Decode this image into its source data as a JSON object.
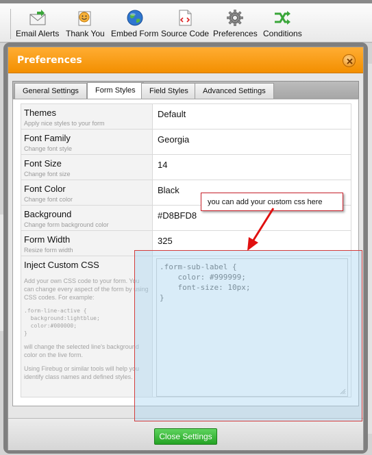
{
  "toolbar": {
    "items": [
      {
        "label": "Email Alerts",
        "icon": "email-icon"
      },
      {
        "label": "Thank You",
        "icon": "thank-you-icon"
      },
      {
        "label": "Embed Form",
        "icon": "globe-icon"
      },
      {
        "label": "Source Code",
        "icon": "source-code-icon"
      },
      {
        "label": "Preferences",
        "icon": "gear-icon"
      },
      {
        "label": "Conditions",
        "icon": "conditions-icon"
      }
    ]
  },
  "modal": {
    "title": "Preferences",
    "tabs": [
      {
        "label": "General Settings",
        "active": false
      },
      {
        "label": "Form Styles",
        "active": true
      },
      {
        "label": "Field Styles",
        "active": false
      },
      {
        "label": "Advanced Settings",
        "active": false
      }
    ],
    "settings": [
      {
        "name": "Themes",
        "desc": "Apply nice styles to your form",
        "value": "Default"
      },
      {
        "name": "Font Family",
        "desc": "Change font style",
        "value": "Georgia"
      },
      {
        "name": "Font Size",
        "desc": "Change font size",
        "value": "14"
      },
      {
        "name": "Font Color",
        "desc": "Change font color",
        "value": "Black"
      },
      {
        "name": "Background",
        "desc": "Change form background color",
        "value": "#D8BFD8"
      },
      {
        "name": "Form Width",
        "desc": "Resize form width",
        "value": "325"
      }
    ],
    "custom_css": {
      "name": "Inject Custom CSS",
      "help_intro": "Add your own CSS code to your form. You can change every aspect of the form by using CSS codes. For example:",
      "help_code": ".form-line-active {\n  background:lightblue;\n  color:#000000;\n}",
      "help_mid": "will change the selected line's background color on the live form.",
      "help_end": "Using Firebug or similar tools will help you identify class names and defined styles.",
      "value": ".form-sub-label {\n    color: #999999;\n    font-size: 10px;\n}"
    },
    "close_settings_label": "Close Settings"
  },
  "annotation": {
    "callout_text": "you can add your custom css here"
  },
  "colors": {
    "header_orange": "#f38f00",
    "button_green": "#24a324",
    "annotation_red": "#d23b3b"
  }
}
